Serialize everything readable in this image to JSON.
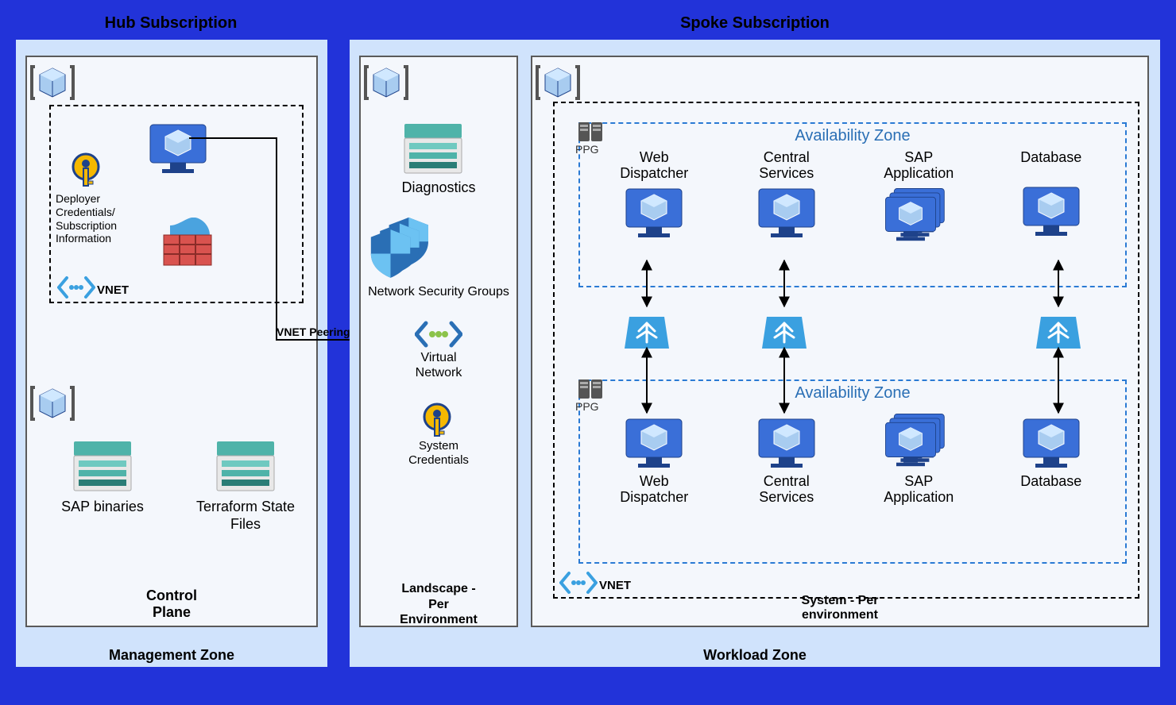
{
  "hub_sub": "Hub Subscription",
  "spoke_sub": "Spoke Subscription",
  "mgmt_zone": "Management Zone",
  "workload_zone": "Workload Zone",
  "control_plane": "Control\nPlane",
  "landscape": "Landscape -\nPer\nEnvironment",
  "system": "System - Per\nenvironment",
  "vnet_peering": "VNET Peering",
  "vnet": "VNET",
  "key_desc": "Deployer\nCredentials/\nSubscription\nInformation",
  "sap_binaries": "SAP binaries",
  "tf_state": "Terraform State\nFiles",
  "diagnostics": "Diagnostics",
  "nsg": "Network Security Groups",
  "vnet_full": "Virtual\nNetwork",
  "sys_creds": "System\nCredentials",
  "az": "Availability Zone",
  "ppg": "PPG",
  "web_dispatcher": "Web\nDispatcher",
  "central_services": "Central\nServices",
  "sap_app": "SAP\nApplication",
  "database": "Database"
}
